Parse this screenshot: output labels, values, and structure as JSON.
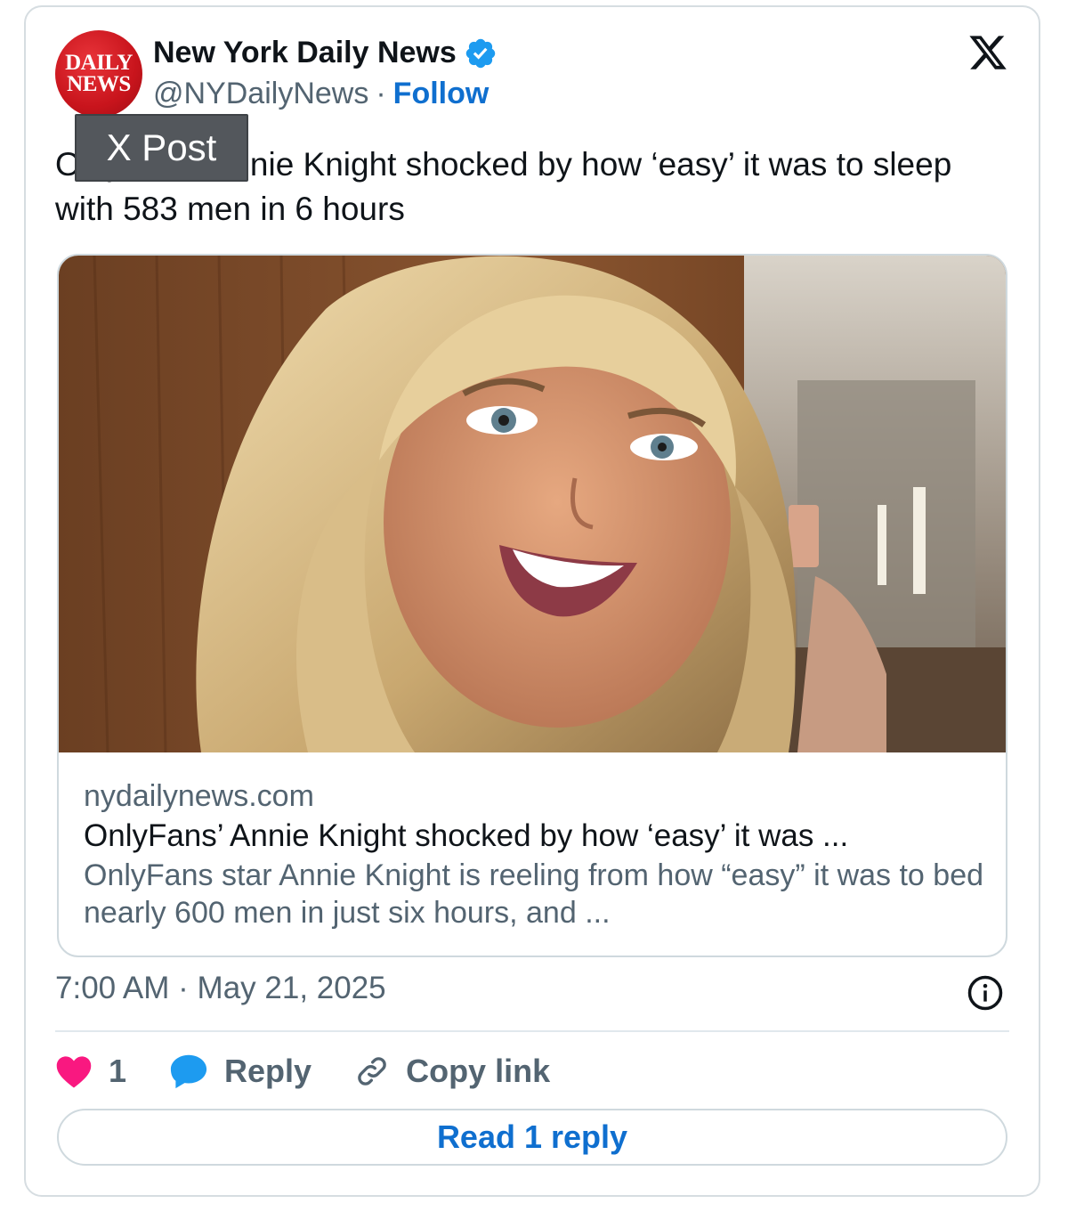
{
  "author": {
    "avatar_text": [
      "DAILY",
      "NEWS"
    ],
    "name": "New York Daily News",
    "handle": "@NYDailyNews",
    "separator": "·",
    "follow_label": "Follow",
    "verified_color": "#1d9bf0"
  },
  "tooltip": {
    "label": "X Post"
  },
  "tweet": {
    "text": "OnlyFans' Annie Knight shocked by how ‘easy’ it was to sleep with 583 men in 6 hours"
  },
  "link_card": {
    "image_icon": "photo-of-smiling-blonde-woman",
    "domain": "nydailynews.com",
    "title": "OnlyFans’ Annie Knight shocked by how ‘easy’ it was ...",
    "description": "OnlyFans star Annie Knight is reeling from how “easy” it was to bed nearly 600 men in just six hours, and ..."
  },
  "meta": {
    "time": "7:00 AM",
    "separator": "·",
    "date": "May 21, 2025",
    "info_icon": "info-icon"
  },
  "actions": {
    "like_count": "1",
    "reply_label": "Reply",
    "copy_label": "Copy link",
    "like_color": "#f91880",
    "reply_color": "#1d9bf0"
  },
  "read_replies_label": "Read 1 reply",
  "brand": {
    "x_logo": "x-logo-icon",
    "link_color": "#0f6fcf"
  }
}
